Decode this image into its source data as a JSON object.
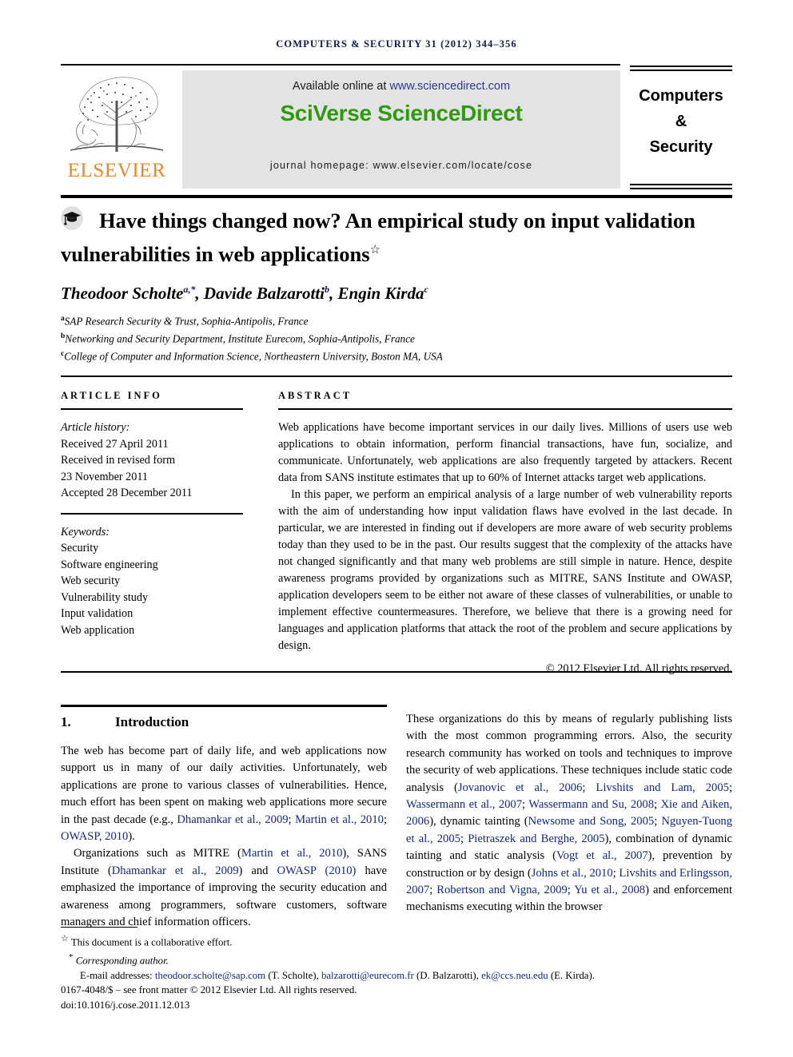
{
  "running_head": "COMPUTERS & SECURITY 31 (2012) 344–356",
  "masthead": {
    "publisher_name": "ELSEVIER",
    "available_prefix": "Available online at ",
    "available_url": "www.sciencedirect.com",
    "platform_name": "SciVerse ScienceDirect",
    "journal_homepage": "journal homepage: www.elsevier.com/locate/cose",
    "journal_box_title": "Computers\n&\nSecurity",
    "journal_box_lines": [
      "Computers",
      "&",
      "Security"
    ],
    "sciverse_green": "#2d9b0d",
    "elsevier_orange": "#ec8624",
    "link_blue": "#2b3a8f"
  },
  "article": {
    "title": "Have things changed now? An empirical study on input validation vulnerabilities in web applications",
    "title_footnote_symbol": "☆",
    "authors_html": "Theodoor Scholte, Davide Balzarotti, Engin Kirda",
    "authors": [
      {
        "name": "Theodoor Scholte",
        "sup": "a,*"
      },
      {
        "name": "Davide Balzarotti",
        "sup": "b"
      },
      {
        "name": "Engin Kirda",
        "sup": "c"
      }
    ],
    "affiliations": [
      {
        "mark": "a",
        "text": "SAP Research Security & Trust, Sophia-Antipolis, France"
      },
      {
        "mark": "b",
        "text": "Networking and Security Department, Institute Eurecom, Sophia-Antipolis, France"
      },
      {
        "mark": "c",
        "text": "College of Computer and Information Science, Northeastern University, Boston MA, USA"
      }
    ]
  },
  "article_info": {
    "heading": "ARTICLE INFO",
    "history_label": "Article history:",
    "history_lines": [
      "Received 27 April 2011",
      "Received in revised form",
      "23 November 2011",
      "Accepted 28 December 2011"
    ],
    "keywords_label": "Keywords:",
    "keywords": [
      "Security",
      "Software engineering",
      "Web security",
      "Vulnerability study",
      "Input validation",
      "Web application"
    ]
  },
  "abstract": {
    "heading": "ABSTRACT",
    "paragraphs": [
      "Web applications have become important services in our daily lives. Millions of users use web applications to obtain information, perform financial transactions, have fun, socialize, and communicate. Unfortunately, web applications are also frequently targeted by attackers. Recent data from SANS institute estimates that up to 60% of Internet attacks target web applications.",
      "In this paper, we perform an empirical analysis of a large number of web vulnerability reports with the aim of understanding how input validation flaws have evolved in the last decade. In particular, we are interested in finding out if developers are more aware of web security problems today than they used to be in the past. Our results suggest that the complexity of the attacks have not changed significantly and that many web problems are still simple in nature. Hence, despite awareness programs provided by organizations such as MITRE, SANS Institute and OWASP, application developers seem to be either not aware of these classes of vulnerabilities, or unable to implement effective countermeasures. Therefore, we believe that there is a growing need for languages and application platforms that attack the root of the problem and secure applications by design."
    ],
    "copyright": "© 2012 Elsevier Ltd. All rights reserved."
  },
  "body": {
    "section_number": "1.",
    "section_title": "Introduction",
    "left_column": [
      "The web has become part of daily life, and web applications now support us in many of our daily activities. Unfortunately, web applications are prone to various classes of vulnerabilities. Hence, much effort has been spent on making web applications more secure in the past decade (e.g., Dhamankar et al., 2009; Martin et al., 2010; OWASP, 2010).",
      "Organizations such as MITRE (Martin et al., 2010), SANS Institute (Dhamankar et al., 2009) and OWASP (2010) have emphasized the importance of improving the security education and awareness among programmers, software customers, software managers and chief information officers."
    ],
    "right_column": [
      "These organizations do this by means of regularly publishing lists with the most common programming errors. Also, the security research community has worked on tools and techniques to improve the security of web applications. These techniques include static code analysis (Jovanovic et al., 2006; Livshits and Lam, 2005; Wassermann et al., 2007; Wassermann and Su, 2008; Xie and Aiken, 2006), dynamic tainting (Newsome and Song, 2005; Nguyen-Tuong et al., 2005; Pietraszek and Berghe, 2005), combination of dynamic tainting and static analysis (Vogt et al., 2007), prevention by construction or by design (Johns et al., 2010; Livshits and Erlingsson, 2007; Robertson and Vigna, 2009; Yu et al., 2008) and enforcement mechanisms executing within the browser"
    ]
  },
  "footnotes": {
    "collaborative": "This document is a collaborative effort.",
    "collaborative_symbol": "☆",
    "corresponding": "Corresponding author.",
    "corresponding_symbol": "*",
    "email_label": "E-mail addresses:",
    "emails": [
      {
        "address": "theodoor.scholte@sap.com",
        "owner": "(T. Scholte)"
      },
      {
        "address": "balzarotti@eurecom.fr",
        "owner": "(D. Balzarotti)"
      },
      {
        "address": "ek@ccs.neu.edu",
        "owner": "(E. Kirda)."
      }
    ],
    "issn_line": "0167-4048/$ – see front matter © 2012 Elsevier Ltd. All rights reserved.",
    "doi_line_label": "doi:",
    "doi_line_value": "10.1016/j.cose.2011.12.013"
  }
}
